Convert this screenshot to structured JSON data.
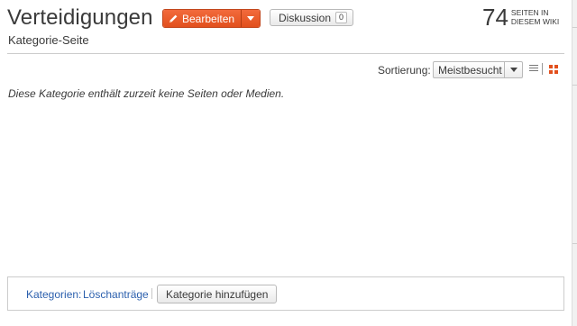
{
  "header": {
    "title": "Verteidigungen",
    "subtitle": "Kategorie-Seite",
    "edit_label": "Bearbeiten",
    "discussion_label": "Diskussion",
    "discussion_count": "0",
    "wiki_page_count": "74",
    "wiki_page_count_label": "Seiten in diesem Wiki"
  },
  "sort": {
    "label": "Sortierung:",
    "selected": "Meistbesucht"
  },
  "main": {
    "empty_message": "Diese Kategorie enthält zurzeit keine Seiten oder Medien."
  },
  "categories": {
    "label": "Kategorien:",
    "items": [
      "Löschanträge"
    ],
    "add_label": "Kategorie hinzufügen"
  },
  "colors": {
    "accent": "#e2501d",
    "link": "#2b5fad"
  }
}
